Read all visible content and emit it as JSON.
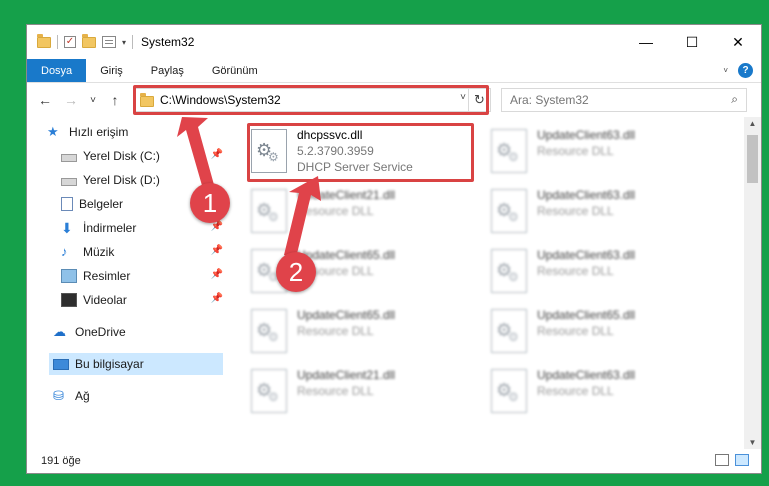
{
  "window": {
    "title": "System32",
    "controls": {
      "minimize": "—",
      "maximize": "☐",
      "close": "✕"
    }
  },
  "ribbon": {
    "tabs": [
      {
        "label": "Dosya",
        "active": true
      },
      {
        "label": "Giriş"
      },
      {
        "label": "Paylaş"
      },
      {
        "label": "Görünüm"
      }
    ],
    "expand_icon": "chevron-down-icon",
    "help_label": "?"
  },
  "navigation": {
    "back": "←",
    "forward": "→",
    "recent": "˅",
    "up": "↑",
    "address": "C:\\Windows\\System32",
    "address_dropdown": "˅",
    "refresh": "↻",
    "search_placeholder": "Ara: System32",
    "search_icon": "⌕"
  },
  "sidebar": {
    "items": [
      {
        "label": "Hızlı erişim",
        "icon": "star-icon",
        "glyph": "★"
      },
      {
        "label": "Yerel Disk (C:)",
        "icon": "disk-icon",
        "pinned": true
      },
      {
        "label": "Yerel Disk (D:)",
        "icon": "disk-icon"
      },
      {
        "label": "Belgeler",
        "icon": "document-icon",
        "pinned": true
      },
      {
        "label": "İndirmeler",
        "icon": "download-icon",
        "glyph": "⬇",
        "pinned": true
      },
      {
        "label": "Müzik",
        "icon": "music-icon",
        "glyph": "♪",
        "pinned": true
      },
      {
        "label": "Resimler",
        "icon": "pictures-icon",
        "pinned": true
      },
      {
        "label": "Videolar",
        "icon": "videos-icon",
        "pinned": true
      },
      {
        "label": "OneDrive",
        "icon": "cloud-icon",
        "glyph": "☁"
      },
      {
        "label": "Bu bilgisayar",
        "icon": "pc-icon",
        "selected": true
      },
      {
        "label": "Ağ",
        "icon": "network-icon",
        "glyph": "⛁"
      }
    ],
    "pin_glyph": "📌"
  },
  "files": {
    "highlighted": {
      "name": "dhcpssvc.dll",
      "version": "5.2.3790.3959",
      "description": "DHCP Server Service"
    },
    "blurred": [
      {
        "name": "UpdateClient63.dll",
        "sub": "Resource DLL"
      },
      {
        "name": "UpdateClient21.dll",
        "sub": "Resource DLL"
      },
      {
        "name": "UpdateClient63.dll",
        "sub": "Resource DLL"
      },
      {
        "name": "UpdateClient65.dll",
        "sub": "Resource DLL"
      },
      {
        "name": "UpdateClient63.dll",
        "sub": "Resource DLL"
      },
      {
        "name": "UpdateClient65.dll",
        "sub": "Resource DLL"
      },
      {
        "name": "UpdateClient65.dll",
        "sub": "Resource DLL"
      },
      {
        "name": "UpdateClient21.dll",
        "sub": "Resource DLL"
      },
      {
        "name": "UpdateClient63.dll",
        "sub": "Resource DLL"
      }
    ]
  },
  "status": {
    "count": "191 öğe"
  },
  "annotations": {
    "marker1": "1",
    "marker2": "2",
    "color": "#e0434a"
  },
  "colors": {
    "accent": "#1979ca",
    "background": "#15a04a",
    "highlight": "#d94343"
  }
}
